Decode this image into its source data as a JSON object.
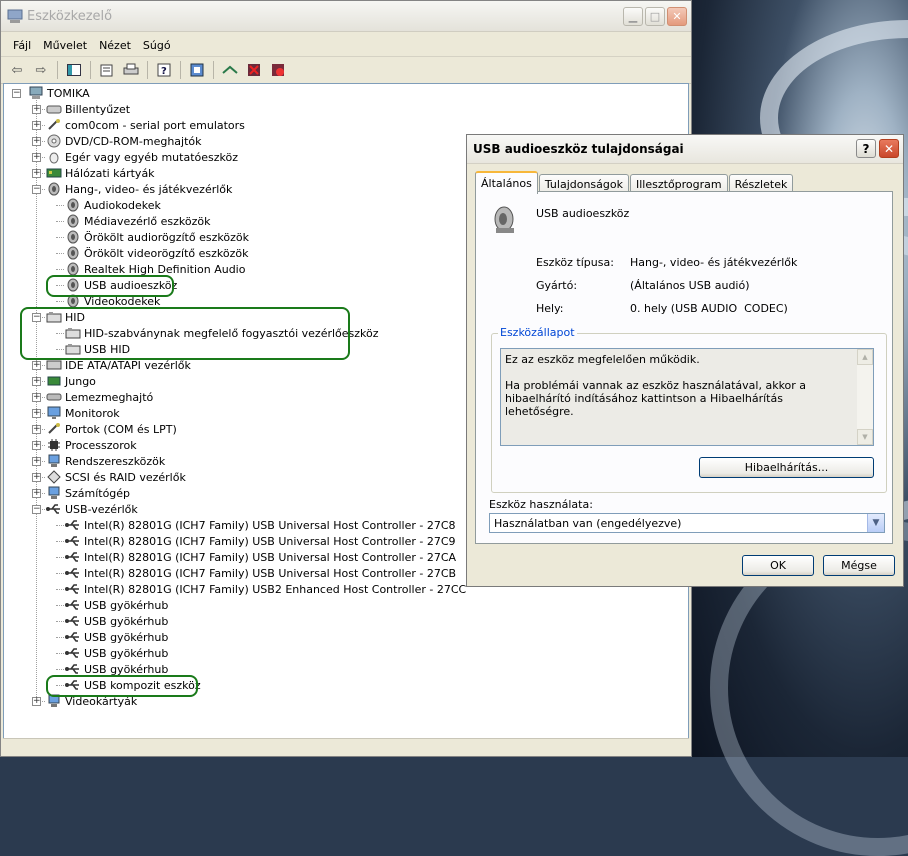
{
  "main_window": {
    "title": "Eszközkezelő",
    "menu": [
      "Fájl",
      "Művelet",
      "Nézet",
      "Súgó"
    ],
    "toolbar_icons": [
      "back-arrow-icon",
      "forward-arrow-icon",
      "tree-view-icon",
      "properties-icon",
      "print-icon",
      "help-icon",
      "scan-hardware-icon",
      "update-driver-icon",
      "disable-device-icon",
      "uninstall-device-icon"
    ]
  },
  "tree": {
    "root": "TOMIKA",
    "items": [
      {
        "label": "Billentyűzet",
        "level": 1,
        "expander": "+",
        "icon": "keyboard-icon"
      },
      {
        "label": "com0com - serial port emulators",
        "level": 1,
        "expander": "+",
        "icon": "port-icon"
      },
      {
        "label": "DVD/CD-ROM-meghajtók",
        "level": 1,
        "expander": "+",
        "icon": "dvd-drive-icon"
      },
      {
        "label": "Egér vagy egyéb mutatóeszköz",
        "level": 1,
        "expander": "+",
        "icon": "mouse-icon"
      },
      {
        "label": "Hálózati kártyák",
        "level": 1,
        "expander": "+",
        "icon": "network-card-icon"
      },
      {
        "label": "Hang-, video- és játékvezérlők",
        "level": 1,
        "expander": "-",
        "icon": "speaker-icon"
      },
      {
        "label": "Audiokodekek",
        "level": 2,
        "icon": "speaker-icon"
      },
      {
        "label": "Médiavezérlő eszközök",
        "level": 2,
        "icon": "speaker-icon"
      },
      {
        "label": "Örökölt audiorögzítő eszközök",
        "level": 2,
        "icon": "speaker-icon"
      },
      {
        "label": "Örökölt videorögzítő eszközök",
        "level": 2,
        "icon": "speaker-icon"
      },
      {
        "label": "Realtek High Definition Audio",
        "level": 2,
        "icon": "speaker-icon"
      },
      {
        "label": "USB audioeszköz",
        "level": 2,
        "icon": "speaker-icon"
      },
      {
        "label": "Videokodekek",
        "level": 2,
        "icon": "speaker-icon"
      },
      {
        "label": "HID",
        "level": 1,
        "expander": "-",
        "icon": "hid-icon"
      },
      {
        "label": "HID-szabványnak megfelelő fogyasztói vezérlőeszköz",
        "level": 2,
        "icon": "hid-icon"
      },
      {
        "label": "USB HID",
        "level": 2,
        "icon": "hid-icon"
      },
      {
        "label": "IDE ATA/ATAPI vezérlők",
        "level": 1,
        "expander": "+",
        "icon": "ide-controller-icon"
      },
      {
        "label": "Jungo",
        "level": 1,
        "expander": "+",
        "icon": "chip-icon"
      },
      {
        "label": "Lemezmeghajtó",
        "level": 1,
        "expander": "+",
        "icon": "disk-drive-icon"
      },
      {
        "label": "Monitorok",
        "level": 1,
        "expander": "+",
        "icon": "monitor-icon"
      },
      {
        "label": "Portok (COM és LPT)",
        "level": 1,
        "expander": "+",
        "icon": "port-icon"
      },
      {
        "label": "Processzorok",
        "level": 1,
        "expander": "+",
        "icon": "processor-icon"
      },
      {
        "label": "Rendszereszközök",
        "level": 1,
        "expander": "+",
        "icon": "system-device-icon"
      },
      {
        "label": "SCSI és RAID vezérlők",
        "level": 1,
        "expander": "+",
        "icon": "scsi-icon"
      },
      {
        "label": "Számítógép",
        "level": 1,
        "expander": "+",
        "icon": "computer-icon"
      },
      {
        "label": "USB-vezérlők",
        "level": 1,
        "expander": "-",
        "icon": "usb-icon"
      },
      {
        "label": "Intel(R) 82801G (ICH7 Family) USB Universal Host Controller - 27C8",
        "level": 2,
        "icon": "usb-icon"
      },
      {
        "label": "Intel(R) 82801G (ICH7 Family) USB Universal Host Controller - 27C9",
        "level": 2,
        "icon": "usb-icon"
      },
      {
        "label": "Intel(R) 82801G (ICH7 Family) USB Universal Host Controller - 27CA",
        "level": 2,
        "icon": "usb-icon"
      },
      {
        "label": "Intel(R) 82801G (ICH7 Family) USB Universal Host Controller - 27CB",
        "level": 2,
        "icon": "usb-icon"
      },
      {
        "label": "Intel(R) 82801G (ICH7 Family) USB2 Enhanced Host Controller - 27CC",
        "level": 2,
        "icon": "usb-icon"
      },
      {
        "label": "USB gyökérhub",
        "level": 2,
        "icon": "usb-icon"
      },
      {
        "label": "USB gyökérhub",
        "level": 2,
        "icon": "usb-icon"
      },
      {
        "label": "USB gyökérhub",
        "level": 2,
        "icon": "usb-icon"
      },
      {
        "label": "USB gyökérhub",
        "level": 2,
        "icon": "usb-icon"
      },
      {
        "label": "USB gyökérhub",
        "level": 2,
        "icon": "usb-icon"
      },
      {
        "label": "USB kompozit eszköz",
        "level": 2,
        "icon": "usb-icon"
      },
      {
        "label": "Videokártyák",
        "level": 1,
        "expander": "+",
        "icon": "display-adapter-icon"
      }
    ]
  },
  "dialog": {
    "title": "USB audioeszköz tulajdonságai",
    "help_label": "?",
    "close_label": "✕",
    "tabs": [
      "Általános",
      "Tulajdonságok",
      "Illesztőprogram",
      "Részletek"
    ],
    "device_name": "USB audioeszköz",
    "fields": [
      {
        "label": "Eszköz típusa:",
        "value": "Hang-, video- és játékvezérlők"
      },
      {
        "label": "Gyártó:",
        "value": "(Általános USB audió)"
      },
      {
        "label": "Hely:",
        "value": "0. hely (USB AUDIO  CODEC)"
      }
    ],
    "status_group_title": "Eszközállapot",
    "status_line1": "Ez az eszköz megfelelően működik.",
    "status_line2": "Ha problémái vannak az eszköz használatával, akkor a hibaelhárító indításához kattintson a Hibaelhárítás lehetőségre.",
    "troubleshoot_button": "Hibaelhárítás...",
    "usage_label": "Eszköz használata:",
    "usage_value": "Használatban van (engedélyezve)",
    "ok_button": "OK",
    "cancel_button": "Mégse"
  }
}
